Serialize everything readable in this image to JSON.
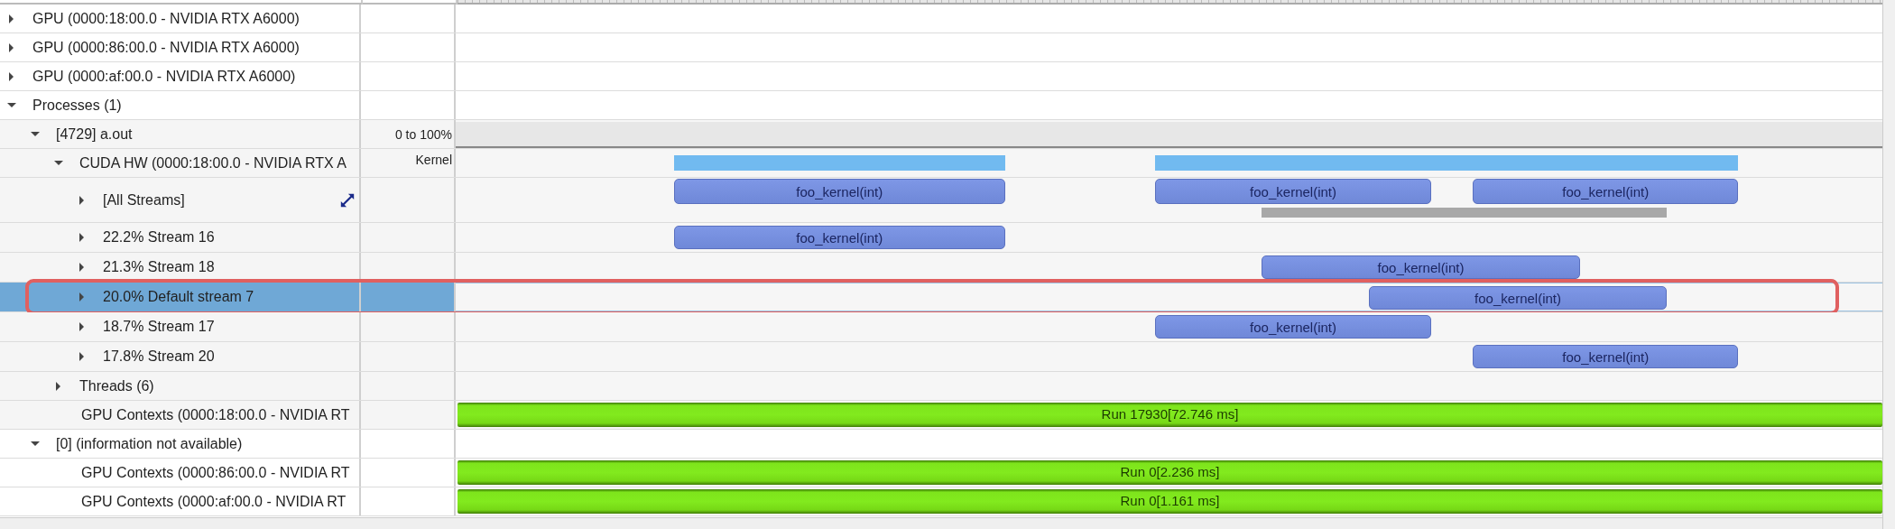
{
  "tree": [
    {
      "label": "GPU (0000:18:00.0 - NVIDIA RTX A6000)",
      "expanded": false
    },
    {
      "label": "GPU (0000:86:00.0 - NVIDIA RTX A6000)",
      "expanded": false
    },
    {
      "label": "GPU (0000:af:00.0 - NVIDIA RTX A6000)",
      "expanded": false
    },
    {
      "label": "Processes (1)",
      "expanded": true,
      "children": [
        {
          "label": "[4729] a.out",
          "expanded": true,
          "value": "0 to 100%",
          "band": true,
          "children": [
            {
              "label": "CUDA HW (0000:18:00.0 - NVIDIA RTX A",
              "expanded": true,
              "value": "Kernel",
              "events": [
                {
                  "kind": "activity"
                },
                {
                  "kind": "activity"
                }
              ],
              "children": [
                {
                  "label": "[All Streams]",
                  "expanded": false,
                  "kind": "tall",
                  "expand_icon": true,
                  "events": [
                    {
                      "kind": "kernel",
                      "label": "foo_kernel(int)"
                    },
                    {
                      "kind": "kernel",
                      "label": "foo_kernel(int)"
                    },
                    {
                      "kind": "kernel",
                      "label": "foo_kernel(int)"
                    },
                    {
                      "kind": "gap"
                    }
                  ]
                },
                {
                  "label": "22.2% Stream 16",
                  "expanded": false,
                  "kind": "stream",
                  "selected": false,
                  "events": [
                    {
                      "kind": "kernel",
                      "label": "foo_kernel(int)"
                    }
                  ]
                },
                {
                  "label": "21.3% Stream 18",
                  "expanded": false,
                  "kind": "stream",
                  "selected": false,
                  "events": [
                    {
                      "kind": "kernel",
                      "label": "foo_kernel(int)"
                    }
                  ]
                },
                {
                  "label": "20.0% Default stream 7",
                  "expanded": false,
                  "kind": "stream",
                  "selected": true,
                  "highlighted": true,
                  "events": [
                    {
                      "kind": "kernel",
                      "label": "foo_kernel(int)"
                    }
                  ]
                },
                {
                  "label": "18.7% Stream 17",
                  "expanded": false,
                  "kind": "stream",
                  "selected": false,
                  "events": [
                    {
                      "kind": "kernel",
                      "label": "foo_kernel(int)"
                    }
                  ]
                },
                {
                  "label": "17.8% Stream 20",
                  "expanded": false,
                  "kind": "stream",
                  "selected": false,
                  "events": [
                    {
                      "kind": "kernel",
                      "label": "foo_kernel(int)"
                    }
                  ]
                }
              ]
            },
            {
              "label": "Threads (6)",
              "expanded": false
            },
            {
              "label": "GPU Contexts (0000:18:00.0 - NVIDIA RT",
              "events": [
                {
                  "kind": "run",
                  "label": "Run 17930[72.746 ms]"
                }
              ]
            }
          ]
        },
        {
          "label": "[0] (information not available)",
          "expanded": true,
          "children": [
            {
              "label": "GPU Contexts (0000:86:00.0 - NVIDIA RT",
              "events": [
                {
                  "kind": "run",
                  "label": "Run 0[2.236 ms]"
                }
              ]
            },
            {
              "label": "GPU Contexts (0000:af:00.0 - NVIDIA RT",
              "events": [
                {
                  "kind": "run",
                  "label": "Run 0[1.161 ms]"
                }
              ]
            }
          ]
        }
      ]
    }
  ]
}
